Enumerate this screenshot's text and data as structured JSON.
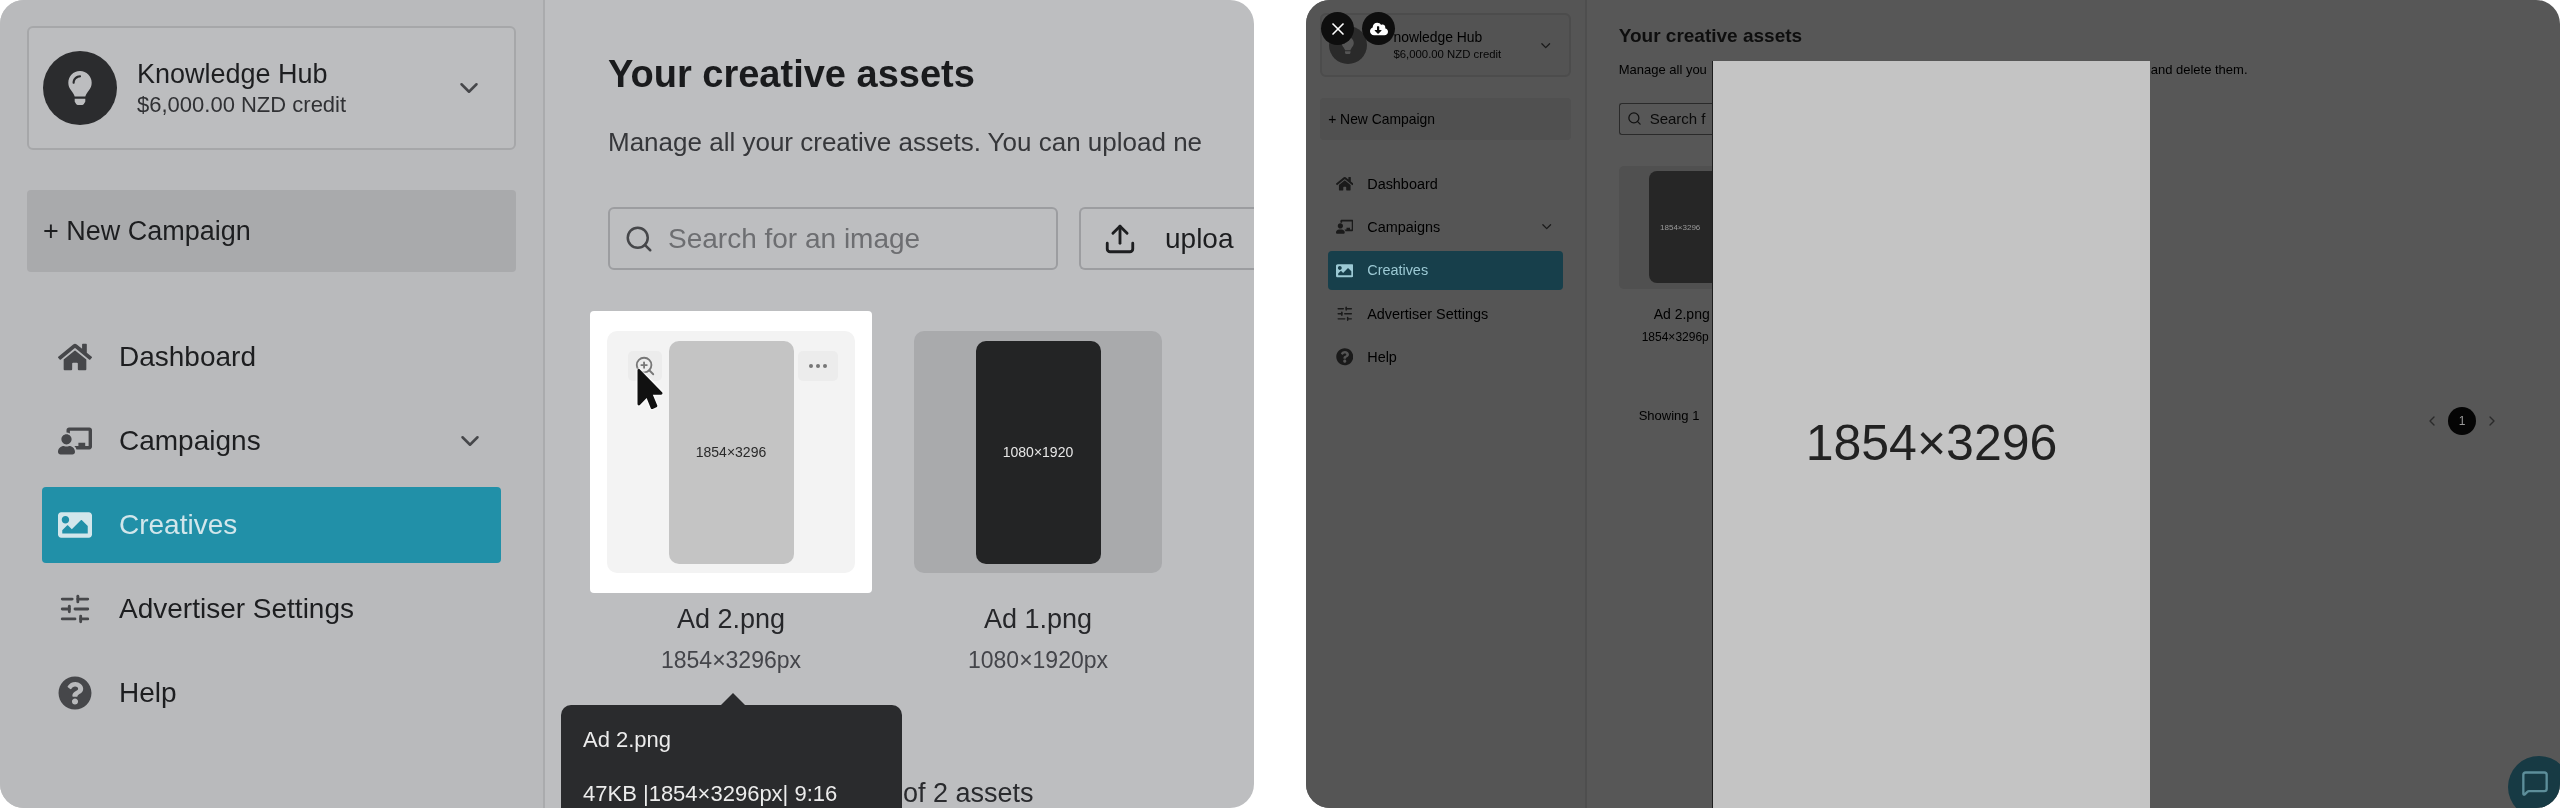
{
  "hover_view": {
    "account": {
      "name": "Knowledge Hub",
      "credit": "$6,000.00 NZD credit"
    },
    "new_campaign": "+ New Campaign",
    "nav": [
      {
        "label": "Dashboard",
        "kind": "link",
        "selected": false
      },
      {
        "label": "Campaigns",
        "kind": "group",
        "selected": false
      },
      {
        "label": "Creatives",
        "kind": "link",
        "selected": true
      },
      {
        "label": "Advertiser Settings",
        "kind": "link",
        "selected": false
      },
      {
        "label": "Help",
        "kind": "link",
        "selected": false
      }
    ],
    "title": "Your creative assets",
    "description": "Manage all your creative assets. You can upload ne",
    "search": {
      "placeholder": "Search for an image"
    },
    "upload_button": "uploa",
    "assets": [
      {
        "name": "Ad 2.png",
        "dimensions": "1854×3296px",
        "preview_label": "1854×3296",
        "kind": "light",
        "hovered": true
      },
      {
        "name": "Ad 1.png",
        "dimensions": "1080×1920px",
        "preview_label": "1080×1920",
        "kind": "dark",
        "hovered": false
      }
    ],
    "tooltip": {
      "title": "Ad 2.png",
      "details": "47KB |1854×3296px| 9:16"
    },
    "footer": "of 2 assets"
  },
  "lightbox_view": {
    "account": {
      "name": "nowledge Hub",
      "credit": "$6,000.00 NZD credit"
    },
    "new_campaign": "+ New Campaign",
    "nav": [
      {
        "label": "Dashboard",
        "kind": "link",
        "selected": false
      },
      {
        "label": "Campaigns",
        "kind": "group",
        "selected": false
      },
      {
        "label": "Creatives",
        "kind": "link",
        "selected": true
      },
      {
        "label": "Advertiser Settings",
        "kind": "link",
        "selected": false
      },
      {
        "label": "Help",
        "kind": "link",
        "selected": false
      }
    ],
    "title": "Your creative assets",
    "description": [
      "Manage all you",
      "and delete them."
    ],
    "search": {
      "placeholder": "Search f"
    },
    "asset": {
      "name": "Ad 2.png",
      "dimensions": "1854×3296p",
      "preview_label": "1854×3296"
    },
    "showing": "Showing 1",
    "pages": [
      {
        "label": "1",
        "selected": true
      }
    ],
    "lightbox": {
      "label": "1854×3296"
    }
  }
}
